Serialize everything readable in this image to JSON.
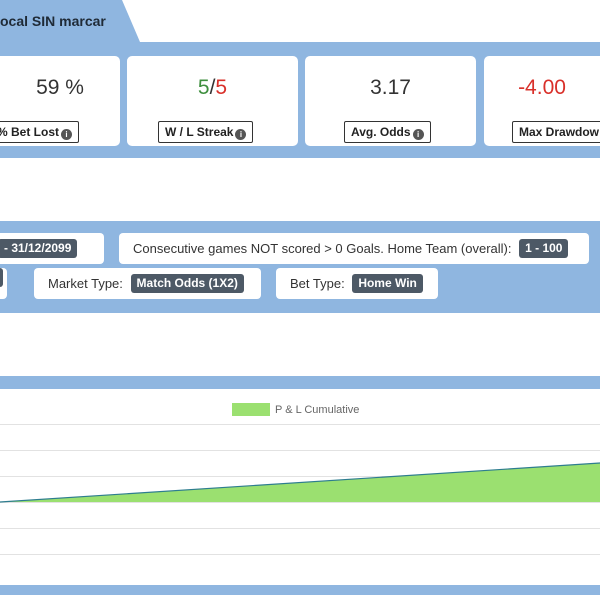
{
  "header": {
    "title": "ocal SIN marcar"
  },
  "stats": [
    {
      "value": "59 %",
      "label": "% Bet Lost"
    },
    {
      "value_win": "5",
      "value_sep": "/",
      "value_loss": "5",
      "label": "W / L Streak"
    },
    {
      "value": "3.17",
      "label": "Avg. Odds"
    },
    {
      "value": "-4.00",
      "label": "Max Drawdow"
    }
  ],
  "filters": {
    "date_range": " - 31/12/2099",
    "consecutive_label": "Consecutive games NOT scored > 0 Goals. Home Team (overall):",
    "consecutive_value": "1 - 100",
    "market_label": "Market Type:",
    "market_value": "Match Odds (1X2)",
    "bet_label": "Bet Type:",
    "bet_value": "Home Win"
  },
  "chart_data": {
    "type": "area",
    "series": [
      {
        "name": "P & L Cumulative",
        "color": "#9be070",
        "line_color": "#2e7d8f",
        "y": [
          0,
          3
        ]
      }
    ],
    "grid": true,
    "legend": "top-center"
  },
  "colors": {
    "band": "#8fb6e0",
    "win": "#3f8f3f",
    "loss": "#d9302a",
    "tag": "#4d5966"
  }
}
